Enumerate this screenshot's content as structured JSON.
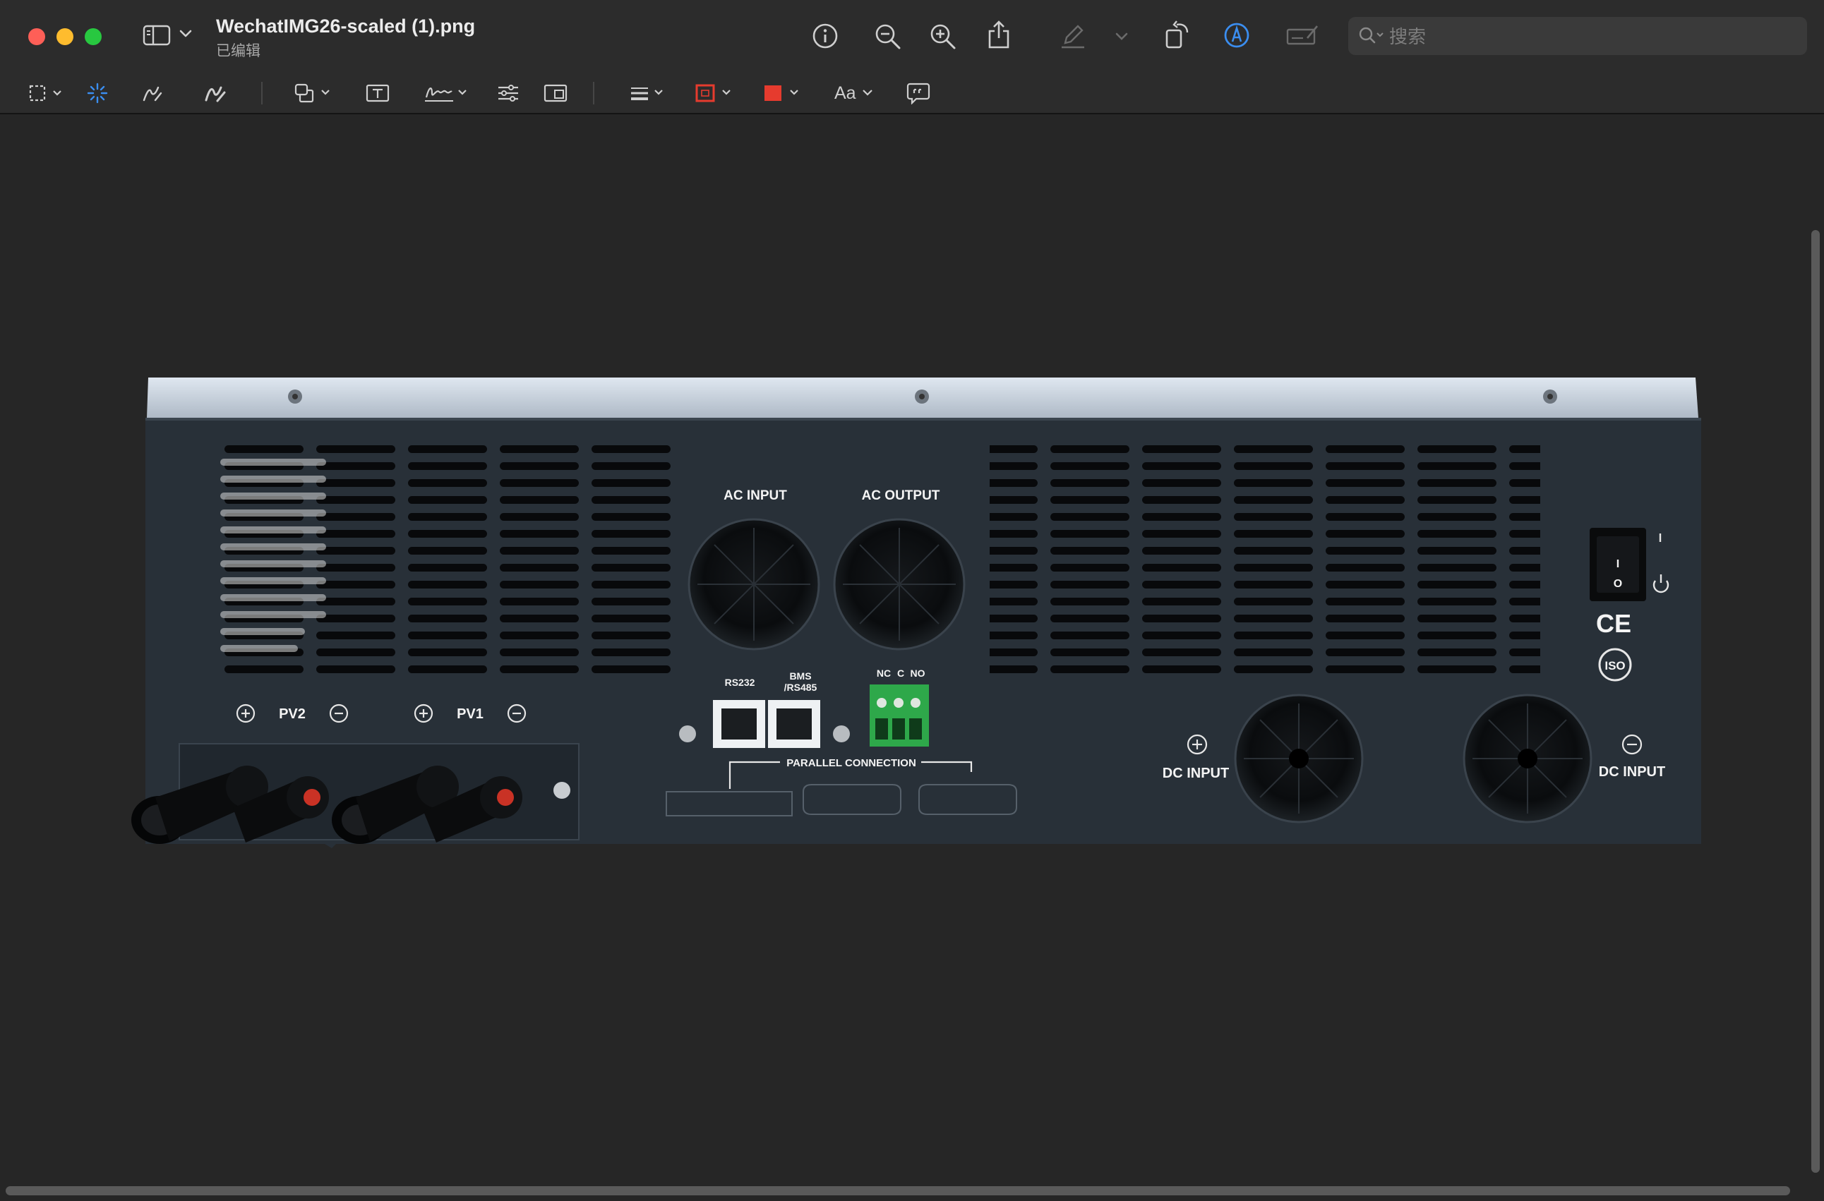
{
  "window": {
    "title": "WechatIMG26-scaled (1).png",
    "subtitle": "已编辑"
  },
  "toolbar": {
    "icons": [
      "sidebar-icon",
      "info-icon",
      "zoom-out-icon",
      "zoom-in-icon",
      "share-icon",
      "highlight-pen-icon",
      "rotate-icon",
      "markup-icon",
      "form-fill-icon"
    ]
  },
  "search": {
    "placeholder": "搜索",
    "value": ""
  },
  "markup": {
    "text_style_label": "Aa",
    "border_color": "#e63b2e",
    "fill_color": "#e63b2e",
    "accent": "#3b8ef0"
  },
  "image": {
    "labels": {
      "ac_input": "AC INPUT",
      "ac_output": "AC OUTPUT",
      "rs232": "RS232",
      "bms_line1": "BMS",
      "bms_line2": "/RS485",
      "nc": "NC",
      "c": "C",
      "no": "NO",
      "pv2": "PV2",
      "pv1": "PV1",
      "parallel": "PARALLEL CONNECTION",
      "dc_input_pos": "DC INPUT",
      "dc_input_neg": "DC INPUT",
      "ce": "CE",
      "iso": "ISO",
      "switch_on": "I",
      "switch_off": "O"
    }
  }
}
